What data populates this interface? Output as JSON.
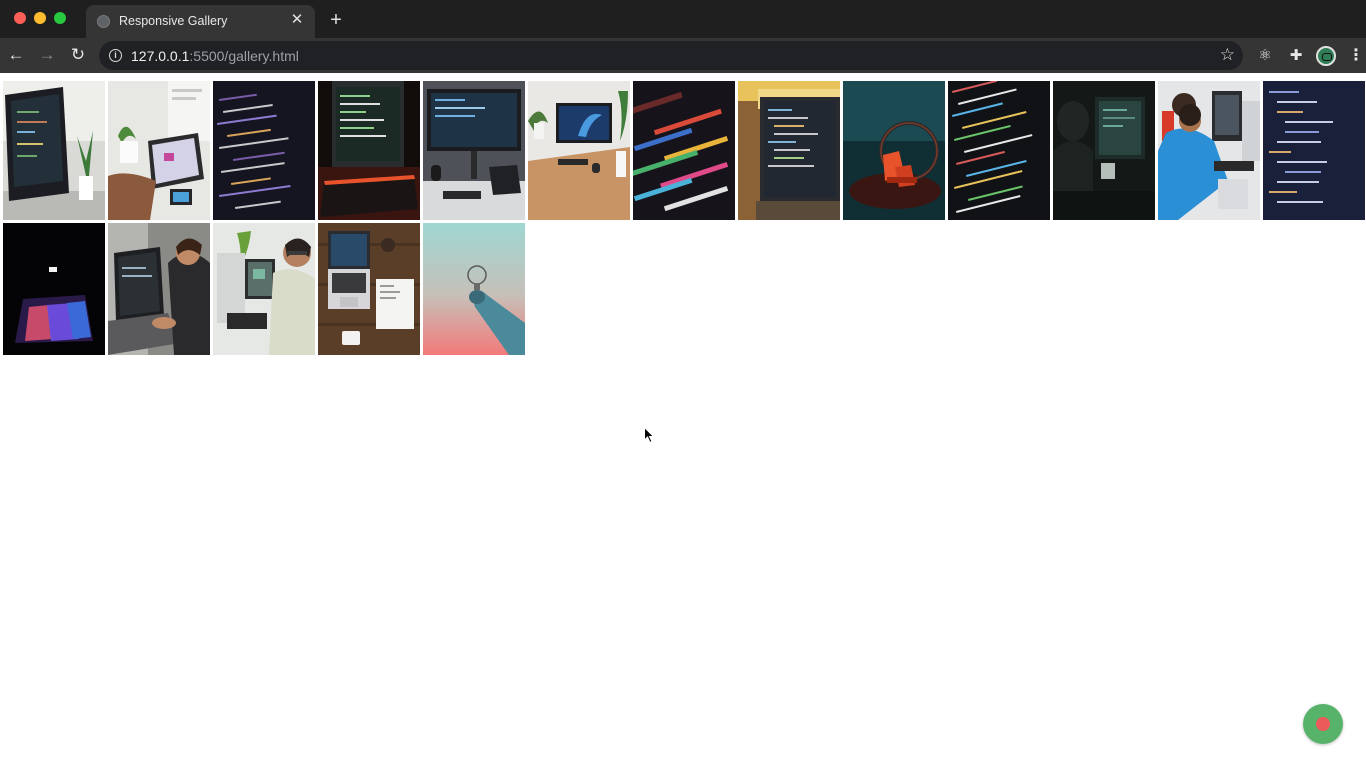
{
  "browser": {
    "tab_title": "Responsive Gallery",
    "url_host": "127.0.0.1",
    "url_path": ":5500/gallery.html"
  },
  "gallery": {
    "row1": [
      "laptop-code-plant",
      "tablet-hands-plant",
      "code-screen-dark",
      "monitor-keyboard-red",
      "monitor-desk-laptop",
      "desk-monitor-plants",
      "blurred-code-color",
      "laptop-code-warm",
      "red-device-teal",
      "code-lines-dark",
      "dark-room-monitor",
      "man-blue-shirt-desk",
      "code-editor-navy"
    ],
    "row2": [
      "purple-light-dark",
      "man-laptop-typing",
      "man-desktop-glasses",
      "laptop-wood-desk",
      "hand-bulb-sky"
    ]
  }
}
